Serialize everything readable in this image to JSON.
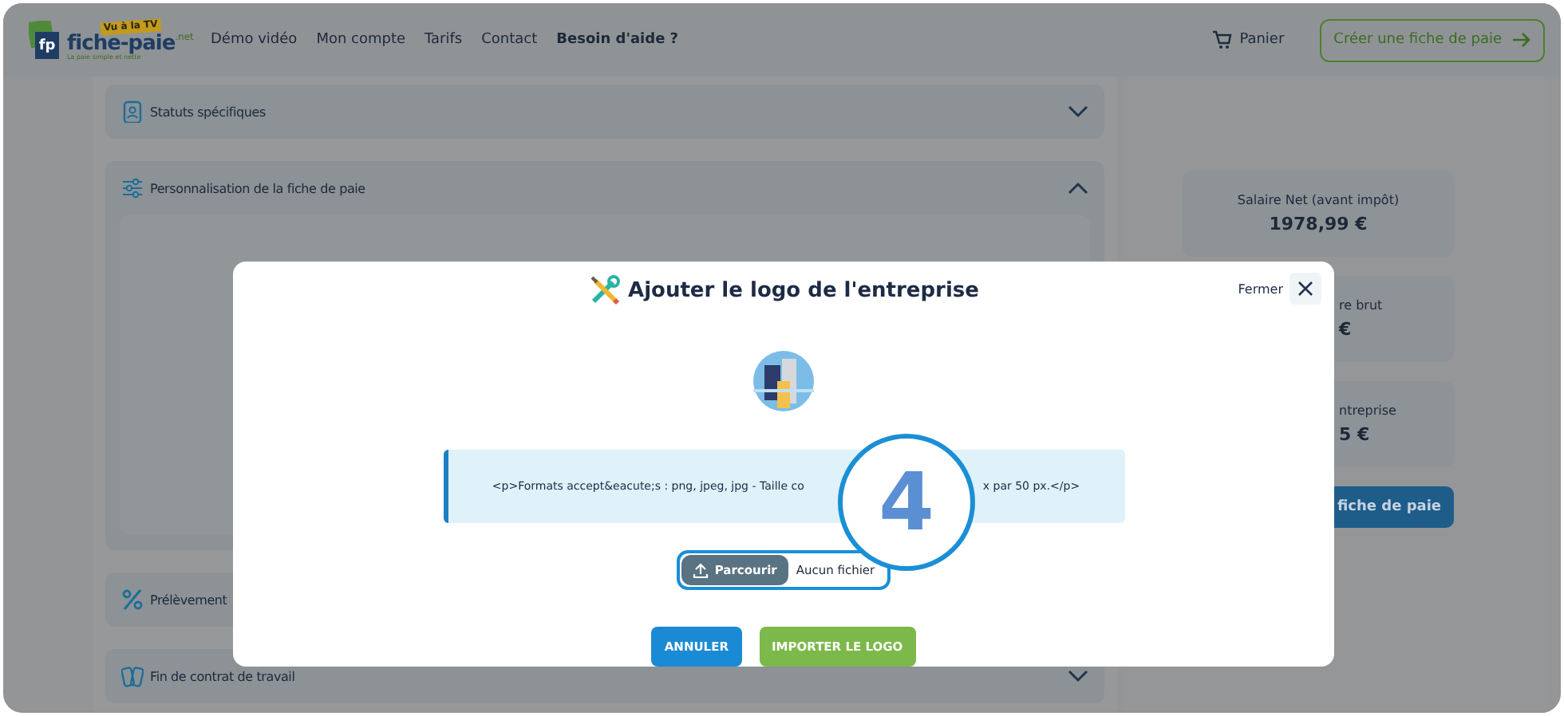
{
  "header": {
    "logo": {
      "mark": "fp",
      "badge": "Vu à la TV",
      "name": "fiche-paie",
      "suffix": ".net",
      "tagline": "La paie simple et nette"
    },
    "nav": [
      {
        "label": "Démo vidéo",
        "emphasized": false
      },
      {
        "label": "Mon compte",
        "emphasized": false
      },
      {
        "label": "Tarifs",
        "emphasized": false
      },
      {
        "label": "Contact",
        "emphasized": false
      },
      {
        "label": "Besoin d'aide ?",
        "emphasized": true
      }
    ],
    "cart": "Panier",
    "cta": "Créer une fiche de paie"
  },
  "sections": [
    {
      "title": "Statuts spécifiques",
      "kind": "document",
      "expanded": false
    },
    {
      "title": "Personnalisation de la fiche de paie",
      "kind": "sliders",
      "expanded": true
    },
    {
      "title": "Prélèvement",
      "kind": "percent"
    },
    {
      "title": "Fin de contrat de travail",
      "kind": "contract",
      "expanded": false
    }
  ],
  "summary": {
    "cards": [
      {
        "label": "Salaire Net (avant impôt)",
        "value": "1978,99 €"
      },
      {
        "label": "re brut",
        "value": "€"
      },
      {
        "label": "ntreprise",
        "value": "5 €"
      }
    ],
    "button": "fiche de paie"
  },
  "modal": {
    "title": "Ajouter le logo de l'entreprise",
    "close_label": "Fermer",
    "info_before": "<p>Formats accept&eacute;s : png, jpeg, jpg - Taille co",
    "info_after": "x par 50 px.</p>",
    "browse": "Parcourir",
    "file_status": "Aucun fichier",
    "cancel": "ANNULER",
    "submit": "IMPORTER LE LOGO"
  },
  "step_marker": "4"
}
